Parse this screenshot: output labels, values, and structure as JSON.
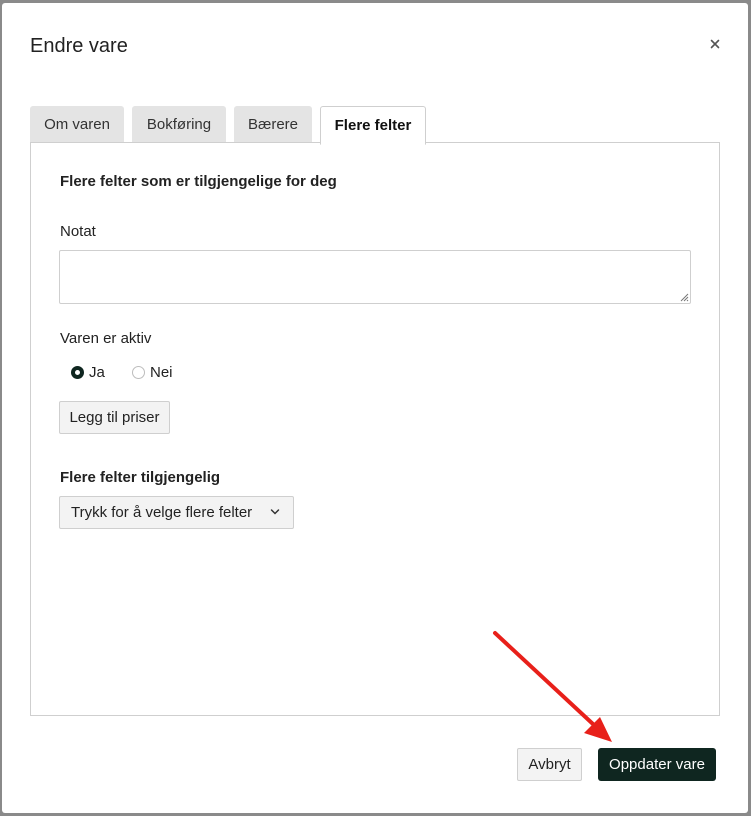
{
  "modal": {
    "title": "Endre vare",
    "close_icon": "close-icon"
  },
  "tabs": [
    {
      "label": "Om varen",
      "active": false
    },
    {
      "label": "Bokføring",
      "active": false
    },
    {
      "label": "Bærere",
      "active": false
    },
    {
      "label": "Flere felter",
      "active": true
    }
  ],
  "panel": {
    "heading": "Flere felter som er tilgjengelige for deg",
    "note_label": "Notat",
    "note_value": "",
    "active_label": "Varen er aktiv",
    "active_options": [
      {
        "label": "Ja",
        "checked": true
      },
      {
        "label": "Nei",
        "checked": false
      }
    ],
    "add_prices_button": "Legg til priser",
    "more_fields_label": "Flere felter tilgjengelig",
    "more_fields_select": "Trykk for å velge flere felter"
  },
  "footer": {
    "cancel_button": "Avbryt",
    "submit_button": "Oppdater vare"
  },
  "colors": {
    "primary": "#0f2620",
    "annotation_arrow": "#e8201a"
  }
}
